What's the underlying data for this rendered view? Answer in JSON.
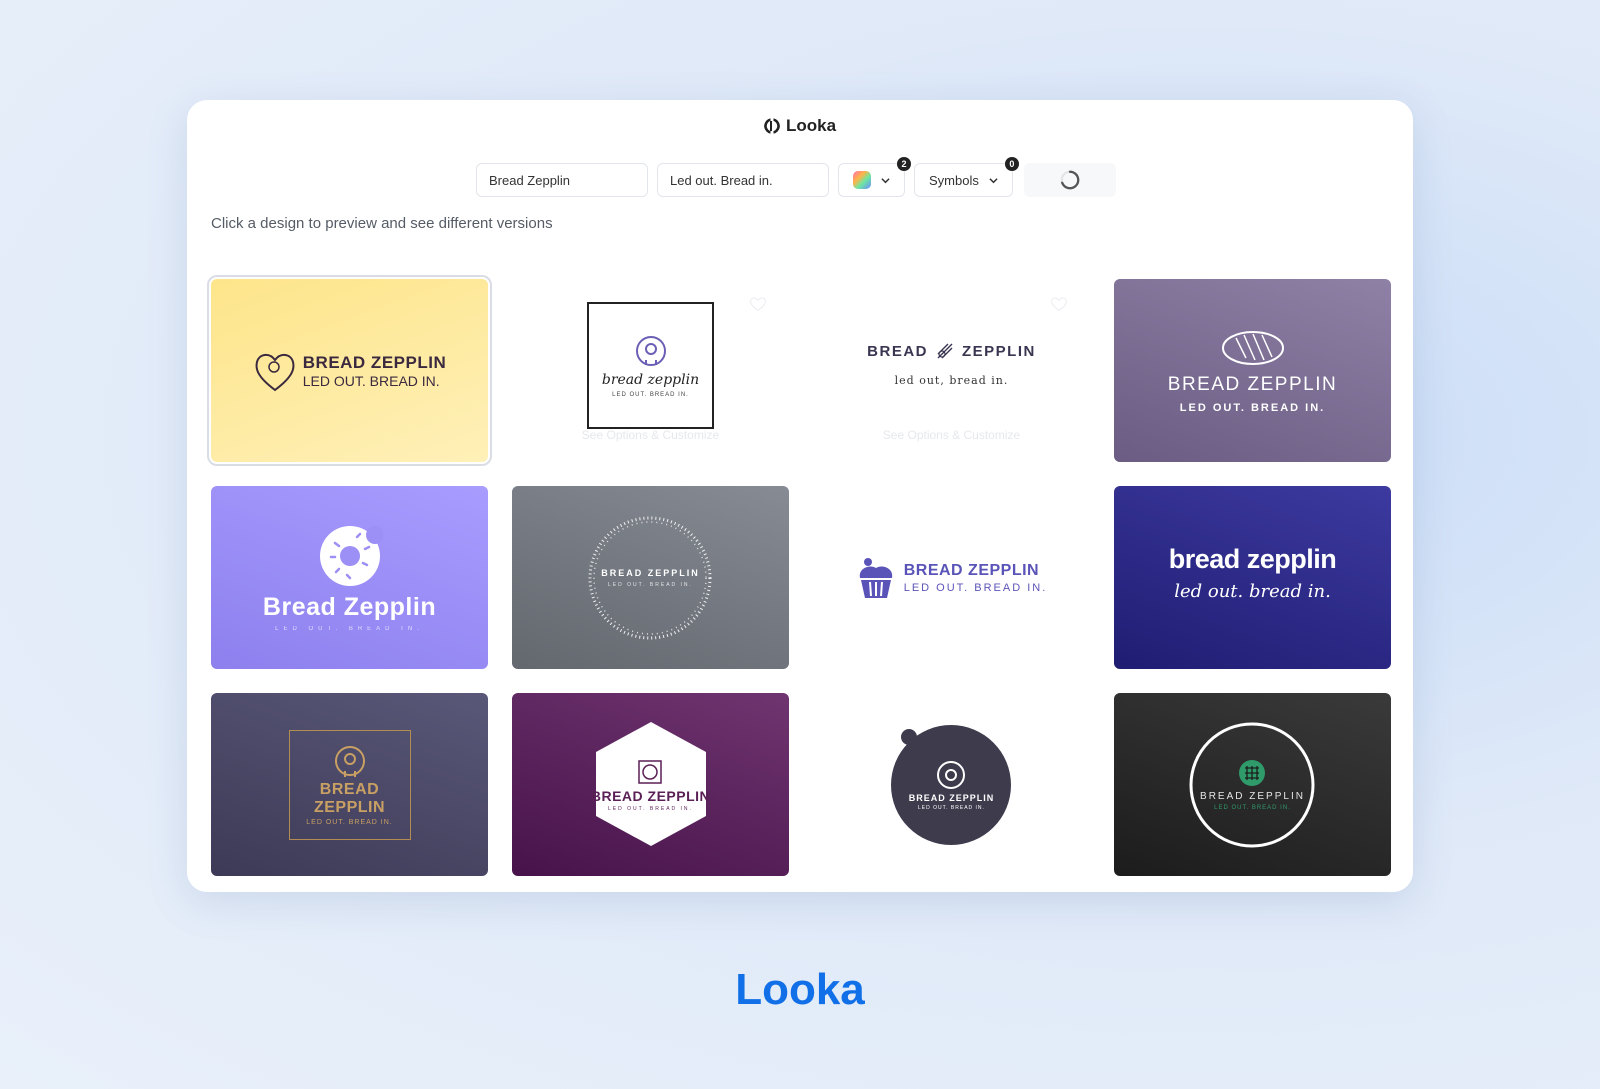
{
  "app": {
    "brand": "Looka"
  },
  "toolbar": {
    "company_name": "Bread Zepplin",
    "slogan": "Led out. Bread in.",
    "colors_count": "2",
    "symbols_label": "Symbols",
    "symbols_count": "0"
  },
  "hint": "Click a design to preview and see different versions",
  "designs": [
    {
      "name": "BREAD ZEPPLIN",
      "tagline": "LED OUT. BREAD IN.",
      "bg": "#fde99a"
    },
    {
      "name": "bread zepplin",
      "tagline": "LED OUT. BREAD IN.",
      "overlay": "See Options & Customize",
      "bg": "#ffffff"
    },
    {
      "name_left": "BREAD",
      "name_right": "ZEPPLIN",
      "tagline": "led out, bread in.",
      "overlay": "See Options & Customize",
      "bg": "#ffffff"
    },
    {
      "name": "BREAD ZEPPLIN",
      "tagline": "LED OUT. BREAD IN.",
      "bg": "#7a6890"
    },
    {
      "name": "Bread Zepplin",
      "tagline": "LED OUT. BREAD IN.",
      "bg": "#9c8ff5"
    },
    {
      "name": "BREAD ZEPPLIN",
      "tagline": "LED OUT. BREAD IN.",
      "bg": "#6e737c"
    },
    {
      "name": "BREAD ZEPPLIN",
      "tagline": "LED OUT. BREAD IN.",
      "bg": "#ffffff"
    },
    {
      "name": "bread zepplin",
      "tagline": "led out. bread in.",
      "bg": "#2c2a8a"
    },
    {
      "name": "BREAD ZEPPLIN",
      "tagline": "LED OUT. BREAD IN.",
      "bg": "#4a4866"
    },
    {
      "name": "BREAD ZEPPLIN",
      "tagline": "LED OUT. BREAD IN.",
      "bg": "#5a1f55"
    },
    {
      "name": "BREAD ZEPPLIN",
      "tagline": "LED OUT. BREAD IN.",
      "bg": "#ffffff"
    },
    {
      "name": "BREAD ZEPPLIN",
      "tagline": "LED OUT. BREAD IN.",
      "bg": "#262626"
    }
  ],
  "footer": {
    "logo": "Looka"
  },
  "colors": {
    "accent": "#1170e8"
  }
}
